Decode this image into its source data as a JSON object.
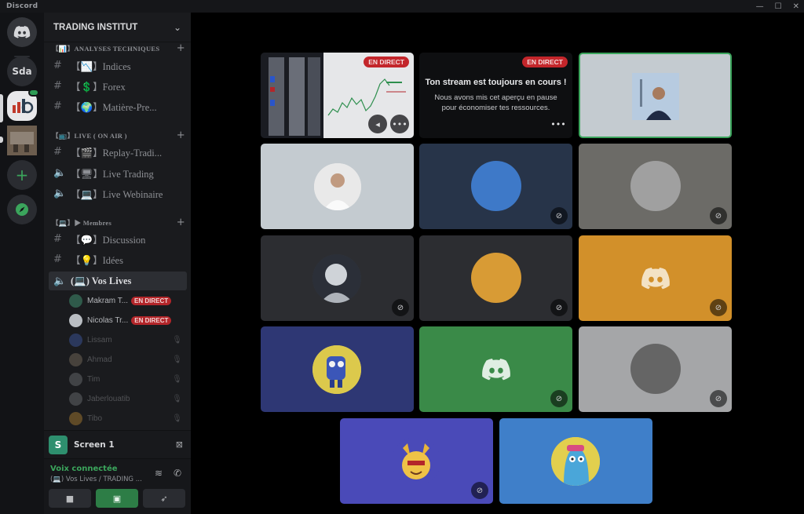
{
  "app": {
    "title": "Discord"
  },
  "window_controls": [
    "—",
    "☐",
    "✕"
  ],
  "rail": {
    "servers": [
      {
        "label": "",
        "icon": "discord-home-icon"
      },
      {
        "label": "Sda"
      },
      {
        "label": "TRADING INSTITUT",
        "icon": "trading-institut-server-icon"
      },
      {
        "label": "",
        "icon": "photo-server-icon"
      }
    ],
    "add_label": "+",
    "explore_label": "✦"
  },
  "guild": {
    "name": "TRADING INSTITUT"
  },
  "categories": [
    {
      "label": "【📊】ANALYSES TECHNIQUES",
      "channels": [
        {
          "label": "【📉】Indices",
          "type": "text"
        },
        {
          "label": "【💲】Forex",
          "type": "text"
        },
        {
          "label": "【🌍】Matière-Pre...",
          "type": "text"
        }
      ]
    },
    {
      "label": "【📺】LIVE ( ON AIR )",
      "channels": [
        {
          "label": "【🎬】Replay-Tradi...",
          "type": "text"
        },
        {
          "label": "【🖥】Live Trading",
          "type": "voice"
        },
        {
          "label": "【💻】Live Webinaire",
          "type": "voice"
        }
      ]
    },
    {
      "label": "【💻】▶ Membres",
      "channels": [
        {
          "label": "【💬】Discussion",
          "type": "text"
        },
        {
          "label": "【💡】Idées",
          "type": "text"
        },
        {
          "label": "(💻) Vos Lives",
          "type": "voice"
        }
      ]
    }
  ],
  "voice_users": [
    {
      "name": "Makram T...",
      "live": "EN DIRECT"
    },
    {
      "name": "Nicolas Tr...",
      "live": "EN DIRECT"
    },
    {
      "name": "Lissam"
    },
    {
      "name": "Ahmad"
    },
    {
      "name": "Tim"
    },
    {
      "name": "Jaberlouatib"
    },
    {
      "name": "Tibo"
    }
  ],
  "screen_share": {
    "initial": "S",
    "label": "Screen 1"
  },
  "voice_panel": {
    "status": "Voix connectée",
    "channel": "(💻) Vos Lives / TRADING ..."
  },
  "stage": {
    "live_tag": "EN DIRECT",
    "paused_title": "Ton stream est toujours en cours !",
    "paused_line1": "Nous avons mis cet aperçu en pause",
    "paused_line2": "pour économiser tes ressources.",
    "more_label": "•••"
  },
  "colors": {
    "tile_grey": "#c4cbd0",
    "tile_navy": "#273449",
    "tile_stone": "#6c6b67",
    "tile_dark": "#2c2d31",
    "tile_orange": "#d2902a",
    "tile_indigo": "#2e3774",
    "tile_green": "#3a8a48",
    "tile_silver": "#a5a6a8",
    "tile_violet": "#4a4ab8",
    "tile_blue": "#3f7fc9",
    "circle_blue": "#3e79c8",
    "circle_grey": "#a0a0a0",
    "circle_orange": "#d89b35",
    "circle_stone": "#656565"
  }
}
